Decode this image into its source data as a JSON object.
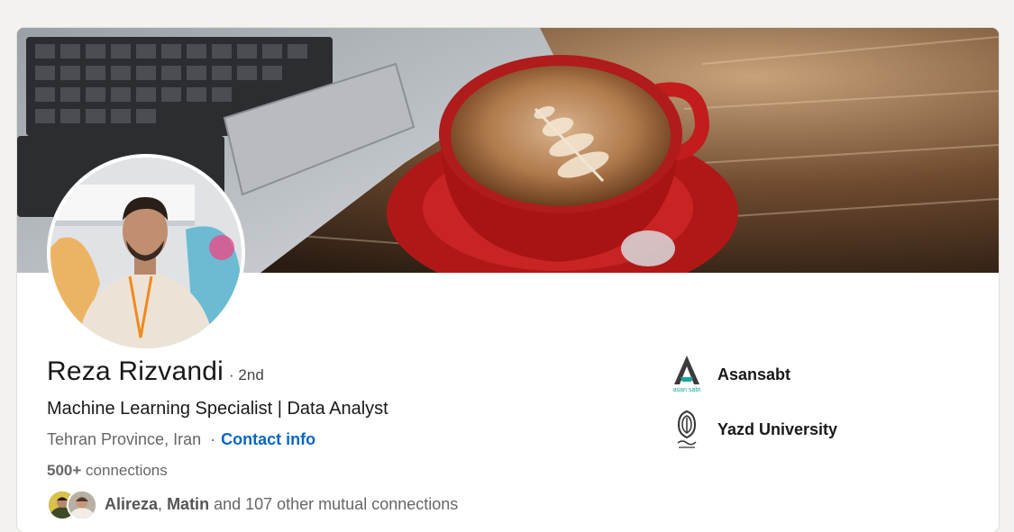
{
  "profile": {
    "name": "Reza Rizvandi",
    "degree": "· 2nd",
    "headline": "Machine Learning Specialist | Data Analyst",
    "location": "Tehran Province, Iran",
    "separator": "·",
    "contact_label": "Contact info",
    "connections_count": "500+",
    "connections_label": "connections",
    "mutual": {
      "name1": "Alireza",
      "comma": ",",
      "name2": "Matin",
      "rest": "and 107 other mutual connections"
    }
  },
  "organizations": [
    {
      "name": "Asansabt",
      "logo": "asansabt-logo",
      "logo_text": "asan sabt"
    },
    {
      "name": "Yazd University",
      "logo": "yazd-university-logo"
    }
  ],
  "colors": {
    "link": "#0a66c2",
    "background": "#f4f2ee",
    "card": "#ffffff",
    "asansabt_teal": "#1aa6a0"
  }
}
